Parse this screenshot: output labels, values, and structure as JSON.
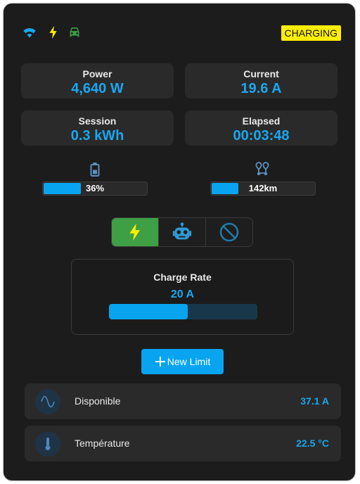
{
  "header": {
    "status": "CHARGING",
    "icons": [
      "wifi-icon",
      "bolt-icon",
      "car-icon"
    ],
    "icon_colors": {
      "wifi": "#1aa7f0",
      "bolt": "#ffee00",
      "car": "#3e9f45"
    }
  },
  "stats": [
    {
      "label": "Power",
      "value": "4,640 W"
    },
    {
      "label": "Current",
      "value": "19.6 A"
    },
    {
      "label": "Session",
      "value": "0.3 kWh"
    },
    {
      "label": "Elapsed",
      "value": "00:03:48"
    }
  ],
  "battery": {
    "text": "36%",
    "level": 0.36,
    "icon": "battery-icon"
  },
  "range": {
    "text": "142km",
    "level": 0.26,
    "icon": "route-icon"
  },
  "modes": [
    {
      "name": "fast",
      "icon": "bolt-icon",
      "active": true
    },
    {
      "name": "auto",
      "icon": "robot-icon",
      "active": false
    },
    {
      "name": "stop",
      "icon": "block-icon",
      "active": false
    }
  ],
  "charge_rate": {
    "title": "Charge Rate",
    "value": "20 A",
    "level": 0.53
  },
  "new_limit_button": {
    "label": "New Limit"
  },
  "info_rows": [
    {
      "label": "Disponible",
      "value": "37.1 A",
      "icon": "sine-wave-icon"
    },
    {
      "label": "Température",
      "value": "22.5 °C",
      "icon": "thermometer-icon"
    }
  ],
  "colors": {
    "accent": "#08a4f0",
    "active_mode": "#3e9f45",
    "badge": "#ffee00",
    "card": "#1c1c1c",
    "tile": "#2a2a2a"
  }
}
